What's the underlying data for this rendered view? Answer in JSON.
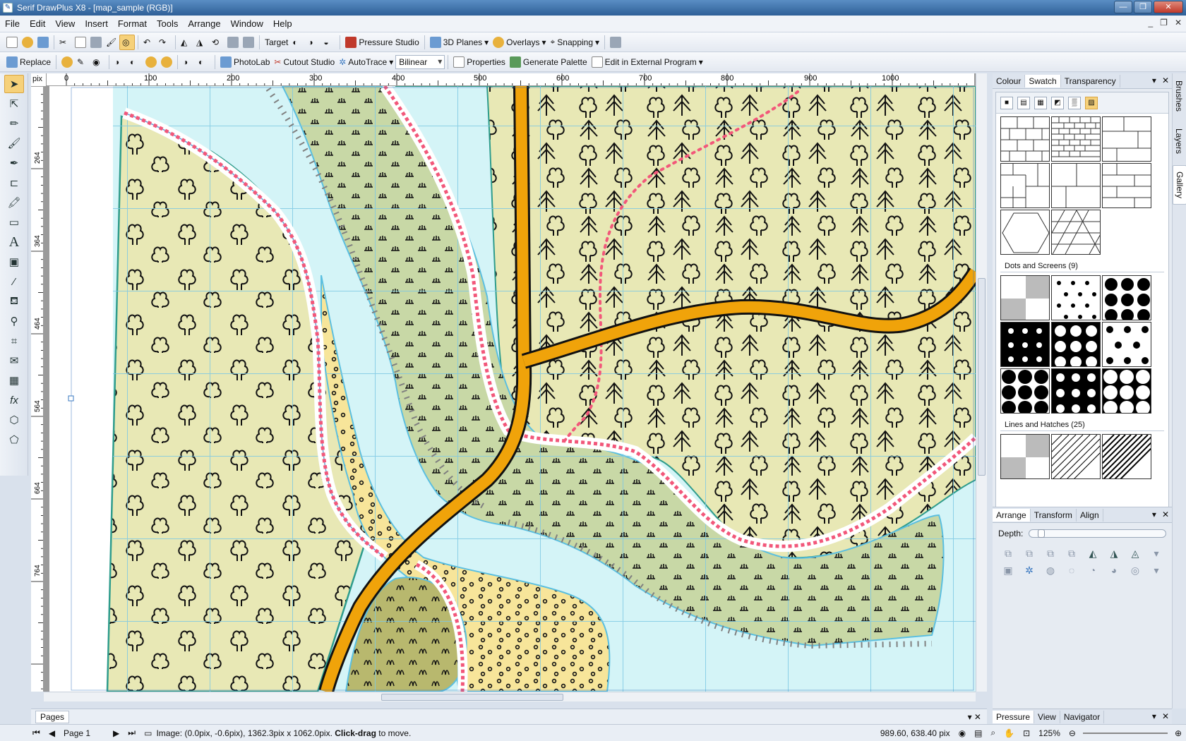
{
  "window": {
    "title": "Serif DrawPlus X8 - [map_sample (RGB)]"
  },
  "menu": [
    "File",
    "Edit",
    "View",
    "Insert",
    "Format",
    "Tools",
    "Arrange",
    "Window",
    "Help"
  ],
  "toolbar1": {
    "target_label": "Target",
    "pressure_label": "Pressure Studio",
    "planes_label": "3D Planes",
    "overlays_label": "Overlays",
    "snapping_label": "Snapping"
  },
  "toolbar2": {
    "replace_label": "Replace",
    "photolab_label": "PhotoLab",
    "cutout_label": "Cutout Studio",
    "autotrace_label": "AutoTrace",
    "resample_value": "Bilinear",
    "properties_label": "Properties",
    "palette_label": "Generate Palette",
    "external_label": "Edit in External Program"
  },
  "ruler": {
    "unit": "pix",
    "h_ticks": [
      "0",
      "100",
      "200",
      "300",
      "400",
      "500",
      "600",
      "700",
      "800",
      "900",
      "1000"
    ],
    "v_ticks": [
      "264",
      "364",
      "464",
      "564",
      "664",
      "764"
    ]
  },
  "colour_panel": {
    "tabs": [
      "Colour",
      "Swatch",
      "Transparency"
    ],
    "active": "Swatch"
  },
  "gallery": {
    "categories": [
      {
        "label": "Dots and Screens (9)"
      },
      {
        "label": "Lines and Hatches (25)"
      }
    ]
  },
  "side_tabs": [
    "Brushes",
    "Layers",
    "Gallery"
  ],
  "arrange_panel": {
    "tabs": [
      "Arrange",
      "Transform",
      "Align"
    ],
    "depth_label": "Depth:"
  },
  "nav_panel": {
    "tabs": [
      "Pressure",
      "View",
      "Navigator"
    ]
  },
  "pages_bar": {
    "label": "Pages"
  },
  "status": {
    "page": "Page 1",
    "info_prefix": "Image: (0.0pix, -0.6pix), 1362.3pix x 1062.0pix. ",
    "info_bold": "Click-drag",
    "info_suffix": " to move.",
    "coords": "989.60, 638.40 pix",
    "zoom": "125%"
  },
  "colors": {
    "land": "#e8e8b5",
    "water": "#d4f4f7",
    "marsh": "#c8d8a6",
    "sand": "#f7e59a",
    "road": "#f0a30a",
    "grid": "#7ec8e3",
    "path": "#f2577a"
  }
}
